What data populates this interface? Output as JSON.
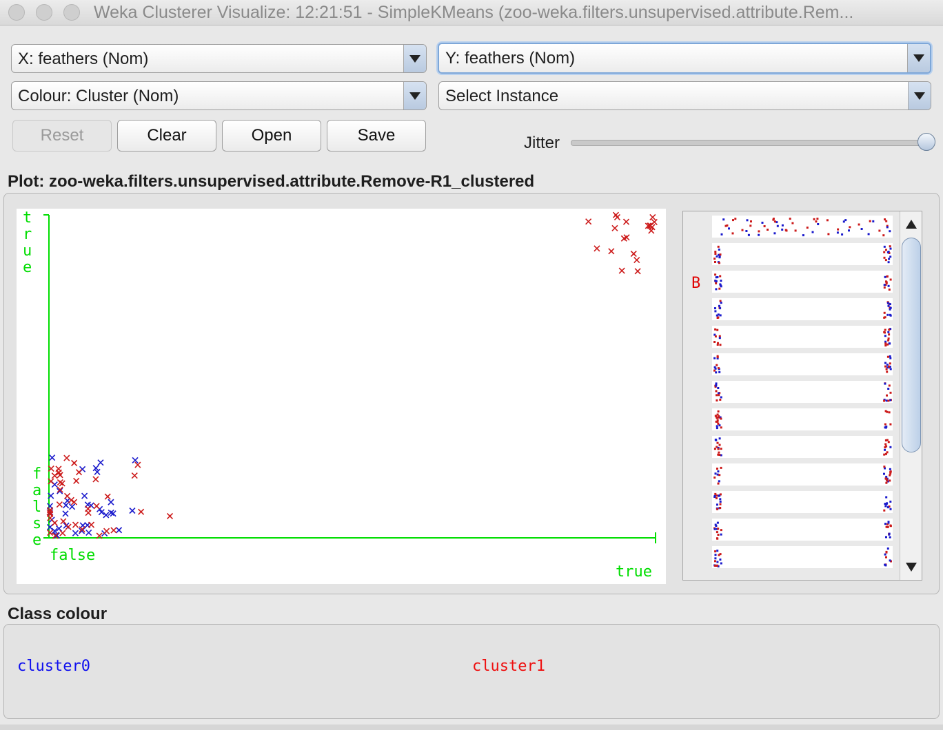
{
  "window": {
    "title": "Weka Clusterer Visualize: 12:21:51 - SimpleKMeans (zoo-weka.filters.unsupervised.attribute.Rem..."
  },
  "controls": {
    "x_axis": "X: feathers (Nom)",
    "y_axis": "Y: feathers (Nom)",
    "colour": "Colour: Cluster (Nom)",
    "select_instance": "Select Instance",
    "buttons": {
      "reset": "Reset",
      "clear": "Clear",
      "open": "Open",
      "save": "Save"
    },
    "jitter_label": "Jitter",
    "jitter_value": 1.0
  },
  "plot": {
    "title": "Plot: zoo-weka.filters.unsupervised.attribute.Remove-R1_clustered",
    "x_false_label": "false",
    "x_true_label": "true",
    "y_true_label": "true",
    "y_false_label": "false",
    "bar_label": "B"
  },
  "class_colour": {
    "title": "Class colour",
    "items": [
      {
        "label": "cluster0",
        "color": "#1010ee"
      },
      {
        "label": "cluster1",
        "color": "#ee1010"
      }
    ]
  },
  "colors": {
    "axis": "#00dd00",
    "cluster0": "#1a1acc",
    "cluster1": "#cc1a1a"
  },
  "chart_data": {
    "type": "scatter",
    "x_attribute": "feathers",
    "y_attribute": "feathers",
    "x_categories": [
      "false",
      "true"
    ],
    "y_categories": [
      "false",
      "true"
    ],
    "jitter": "max",
    "series": [
      {
        "name": "cluster0",
        "color": "#1a1acc",
        "count_at": {
          "false,false": 39,
          "true,true": 0
        }
      },
      {
        "name": "cluster1",
        "color": "#cc1a1a",
        "count_at": {
          "false,false": 42,
          "true,true": 20
        }
      }
    ]
  }
}
